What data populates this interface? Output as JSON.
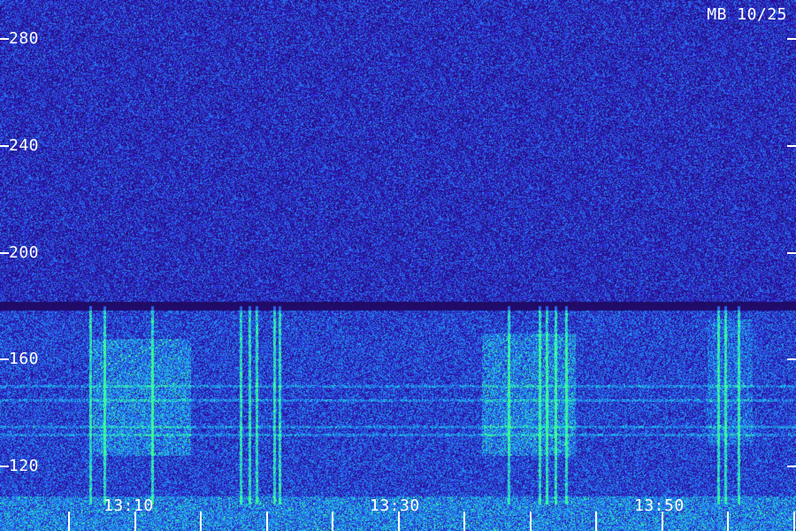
{
  "chart_data": {
    "type": "heatmap",
    "title": "",
    "tag": "MB 10/25",
    "y_ticks": [
      120,
      160,
      200,
      240,
      280
    ],
    "ylim": [
      110,
      295
    ],
    "x_tick_labels": [
      "13:10",
      "13:30",
      "13:50"
    ],
    "x_minor_tick_count": 12,
    "grid": false,
    "colors": {
      "background": "#1a0f55",
      "low": "#3a20c0",
      "mid": "#1a5ee0",
      "high": "#22d0e8",
      "peak": "#30ff80",
      "label": "#ffffff"
    },
    "features": [
      {
        "kind": "band",
        "y_from": 179,
        "y_to": 181,
        "level": "dark"
      },
      {
        "kind": "burst",
        "x_label": "13:10",
        "y_from": 125,
        "y_to": 165,
        "level": "high"
      },
      {
        "kind": "burst",
        "x_label": "13:30",
        "y_from": 125,
        "y_to": 170,
        "level": "high"
      },
      {
        "kind": "burst",
        "x_label": "13:50",
        "y_from": 130,
        "y_to": 175,
        "level": "mid"
      }
    ]
  }
}
